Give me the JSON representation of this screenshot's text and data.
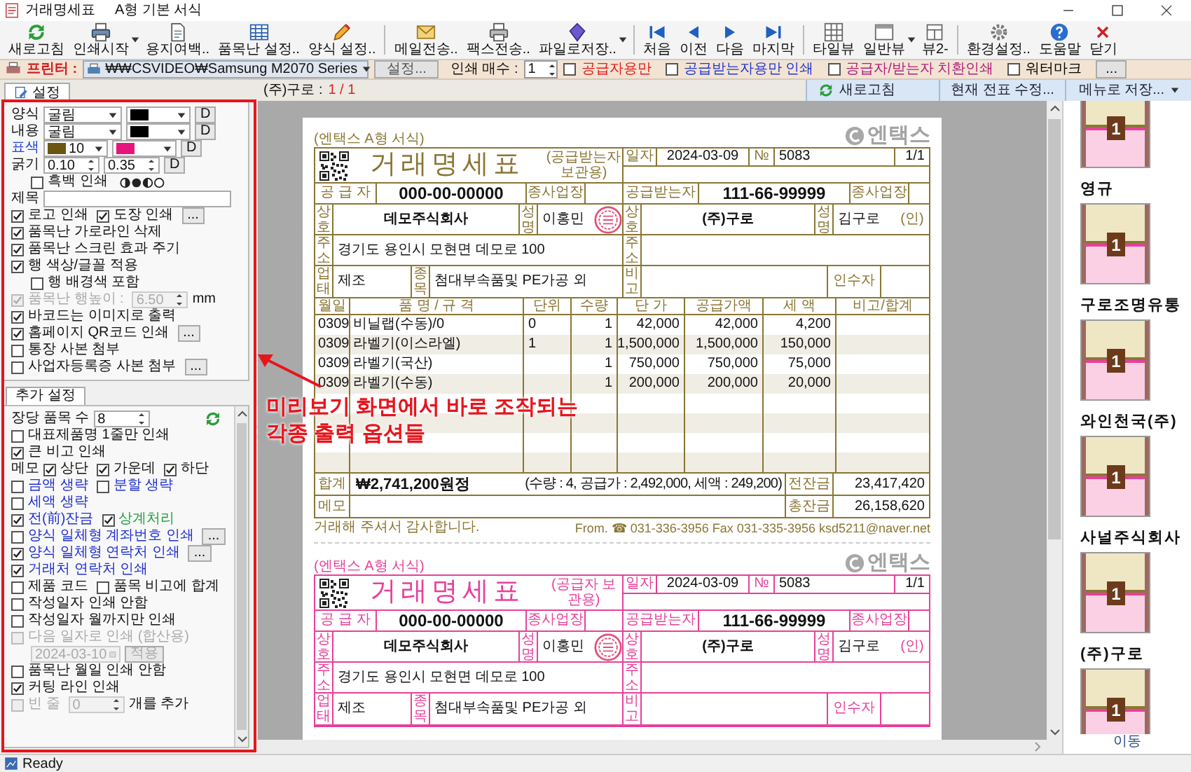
{
  "window": {
    "title": "거래명세표",
    "subtitle": "A형 기본 서식"
  },
  "toolbar": {
    "groups": [
      {
        "buttons": [
          {
            "label": "새로고침",
            "dropdown": false
          },
          {
            "label": "인쇄시작",
            "dropdown": true
          },
          {
            "label": "용지여백..",
            "dropdown": false
          },
          {
            "label": "품목난 설정..",
            "dropdown": false
          },
          {
            "label": "양식 설정..",
            "dropdown": false
          }
        ]
      },
      {
        "buttons": [
          {
            "label": "메일전송..",
            "dropdown": false
          },
          {
            "label": "팩스전송..",
            "dropdown": false
          },
          {
            "label": "파일로저장..",
            "dropdown": true
          }
        ]
      },
      {
        "buttons": [
          {
            "label": "처음",
            "dropdown": false
          },
          {
            "label": "이전",
            "dropdown": false
          },
          {
            "label": "다음",
            "dropdown": false
          },
          {
            "label": "마지막",
            "dropdown": false
          }
        ]
      },
      {
        "buttons": [
          {
            "label": "타일뷰",
            "dropdown": false
          },
          {
            "label": "일반뷰",
            "dropdown": true
          },
          {
            "label": "뷰2-",
            "dropdown": false
          }
        ]
      },
      {
        "buttons": [
          {
            "label": "환경설정..",
            "dropdown": false
          },
          {
            "label": "도움말",
            "dropdown": false
          },
          {
            "label": "닫기",
            "dropdown": false
          }
        ]
      }
    ]
  },
  "printer_bar": {
    "label": "프린터 :",
    "printer": "₩₩CSVIDEO₩Samsung M2070 Series",
    "setup_button": "설정...",
    "copies_label": "인쇄 매수 :",
    "copies": "1",
    "options": [
      {
        "label": "공급자용만",
        "checked": false,
        "color": "#e0201c"
      },
      {
        "label": "공급받는자용만 인쇄",
        "checked": false,
        "color": "#2038d0"
      },
      {
        "label": "공급자/받는자 치환인쇄",
        "checked": false,
        "color": "#b0207c"
      },
      {
        "label": "워터마크",
        "checked": false,
        "color": "#000000"
      }
    ],
    "more_button": "..."
  },
  "preview_header": {
    "customer": "(주)구로 :",
    "page": "1 / 1",
    "buttons": [
      {
        "label": "새로고침",
        "kind": "refresh"
      },
      {
        "label": "현재 전표 수정...",
        "kind": "plain"
      },
      {
        "label": "메뉴로 저장...",
        "kind": "dropdown"
      }
    ]
  },
  "settings_tab": {
    "label": "설정",
    "rows": [
      {
        "kind": "plain",
        "items": [
          {
            "kind": "text",
            "text": "양식"
          },
          {
            "kind": "combo",
            "value": "굴림"
          },
          {
            "kind": "swatch",
            "color": "#000000"
          },
          {
            "kind": "button",
            "label": "D"
          }
        ]
      },
      {
        "kind": "plain",
        "items": [
          {
            "kind": "text",
            "text": "내용"
          },
          {
            "kind": "combo",
            "value": "굴림"
          },
          {
            "kind": "swatch",
            "color": "#000000"
          },
          {
            "kind": "button",
            "label": "D"
          }
        ]
      },
      {
        "kind": "plain",
        "items": [
          {
            "kind": "text",
            "text": "표색",
            "color": "#2040e0"
          },
          {
            "kind": "swatch",
            "color": "#6b5514",
            "value": "10"
          },
          {
            "kind": "swatch",
            "color": "#e8147c"
          },
          {
            "kind": "button",
            "label": "D"
          }
        ]
      },
      {
        "kind": "plain",
        "items": [
          {
            "kind": "text",
            "text": "굵기"
          },
          {
            "kind": "spin",
            "value": "0.10"
          },
          {
            "kind": "spin",
            "value": "0.35"
          },
          {
            "kind": "button",
            "label": "D"
          }
        ]
      },
      {
        "kind": "indented",
        "items": [
          {
            "kind": "check",
            "label": "흑백 인쇄",
            "checked": false
          },
          {
            "kind": "icon"
          }
        ]
      },
      {
        "kind": "plain",
        "items": [
          {
            "kind": "text",
            "text": "제목"
          },
          {
            "kind": "field"
          }
        ]
      },
      {
        "kind": "plain",
        "items": [
          {
            "kind": "check",
            "label": "로고 인쇄",
            "checked": true
          },
          {
            "kind": "check",
            "label": "도장 인쇄",
            "checked": true
          },
          {
            "kind": "button",
            "label": "..."
          }
        ]
      },
      {
        "kind": "plain",
        "items": [
          {
            "kind": "check",
            "label": "품목난 가로라인 삭제",
            "checked": true
          }
        ]
      },
      {
        "kind": "plain",
        "items": [
          {
            "kind": "check",
            "label": "품목난 스크린 효과 주기",
            "checked": true
          }
        ]
      },
      {
        "kind": "plain",
        "items": [
          {
            "kind": "check",
            "label": "행 색상/글꼴 적용",
            "checked": true
          }
        ]
      },
      {
        "kind": "indented",
        "items": [
          {
            "kind": "check",
            "label": "행 배경색 포함",
            "checked": false
          }
        ]
      },
      {
        "kind": "plain",
        "items": [
          {
            "kind": "check",
            "label": "품목난 행높이 :",
            "checked": true,
            "disabled": true
          },
          {
            "kind": "spin",
            "value": "6.50",
            "disabled": true
          },
          {
            "kind": "text",
            "text": "mm"
          }
        ]
      },
      {
        "kind": "plain",
        "items": [
          {
            "kind": "check",
            "label": "바코드는 이미지로 출력",
            "checked": true
          }
        ]
      },
      {
        "kind": "plain",
        "items": [
          {
            "kind": "check",
            "label": "홈페이지 QR코드 인쇄",
            "checked": true
          },
          {
            "kind": "button",
            "label": "..."
          }
        ]
      },
      {
        "kind": "plain",
        "items": [
          {
            "kind": "check",
            "label": "통장 사본 첨부",
            "checked": false
          }
        ]
      },
      {
        "kind": "plain",
        "items": [
          {
            "kind": "check",
            "label": "사업자등록증 사본 첨부",
            "checked": false
          },
          {
            "kind": "button",
            "label": "..."
          }
        ]
      }
    ]
  },
  "extra_tab": {
    "label": "추가 설정",
    "rows": [
      {
        "kind": "plain",
        "items": [
          {
            "kind": "text",
            "text": "장당 품목 수"
          },
          {
            "kind": "spin",
            "value": "8"
          },
          {
            "kind": "refresh"
          }
        ]
      },
      {
        "kind": "plain",
        "items": [
          {
            "kind": "check",
            "label": "대표제품명 1줄만 인쇄",
            "checked": false
          }
        ]
      },
      {
        "kind": "plain",
        "items": [
          {
            "kind": "check",
            "label": "큰 비고 인쇄",
            "checked": true
          }
        ]
      },
      {
        "kind": "plain",
        "items": [
          {
            "kind": "text",
            "text": "메모"
          },
          {
            "kind": "check",
            "label": "상단",
            "checked": true
          },
          {
            "kind": "check",
            "label": "가운데",
            "checked": true
          },
          {
            "kind": "check",
            "label": "하단",
            "checked": true
          }
        ]
      },
      {
        "kind": "plain",
        "items": [
          {
            "kind": "check",
            "label": "금액 생략",
            "checked": false,
            "color": "#2030d0"
          },
          {
            "kind": "check",
            "label": "분할 생략",
            "checked": false,
            "color": "#2030d0"
          }
        ]
      },
      {
        "kind": "plain",
        "items": [
          {
            "kind": "check",
            "label": "세액 생략",
            "checked": false,
            "color": "#2030d0"
          }
        ]
      },
      {
        "kind": "plain",
        "items": [
          {
            "kind": "check",
            "label": "전(前)잔금",
            "checked": true,
            "color": "#2030d0"
          },
          {
            "kind": "check",
            "label": "상계처리",
            "checked": true,
            "color": "#20a040"
          }
        ]
      },
      {
        "kind": "plain",
        "items": [
          {
            "kind": "check",
            "label": "양식 일체형 계좌번호 인쇄",
            "checked": false,
            "color": "#2030d0"
          },
          {
            "kind": "button",
            "label": "..."
          }
        ]
      },
      {
        "kind": "plain",
        "items": [
          {
            "kind": "check",
            "label": "양식 일체형 연락처 인쇄",
            "checked": true,
            "color": "#2030d0"
          },
          {
            "kind": "button",
            "label": "..."
          }
        ]
      },
      {
        "kind": "plain",
        "items": [
          {
            "kind": "check",
            "label": "거래처 연락처 인쇄",
            "checked": true,
            "color": "#2030d0"
          }
        ]
      },
      {
        "kind": "plain",
        "items": [
          {
            "kind": "check",
            "label": "제품 코드",
            "checked": false
          },
          {
            "kind": "check",
            "label": "품목 비고에 합계",
            "checked": false
          }
        ]
      },
      {
        "kind": "plain",
        "items": [
          {
            "kind": "check",
            "label": "작성일자 인쇄 안함",
            "checked": false
          }
        ]
      },
      {
        "kind": "plain",
        "items": [
          {
            "kind": "check",
            "label": "작성일자 월까지만 인쇄",
            "checked": false
          }
        ]
      },
      {
        "kind": "plain",
        "items": [
          {
            "kind": "check",
            "label": "다음 일자로 인쇄 (합산용)",
            "checked": false,
            "disabled": true
          }
        ]
      },
      {
        "kind": "indented",
        "items": [
          {
            "kind": "date",
            "value": "2024-03-10",
            "disabled": true
          },
          {
            "kind": "button",
            "label": "적용",
            "disabled": true
          }
        ]
      },
      {
        "kind": "plain",
        "items": [
          {
            "kind": "check",
            "label": "품목난 월일 인쇄 안함",
            "checked": false
          }
        ]
      },
      {
        "kind": "plain",
        "items": [
          {
            "kind": "check",
            "label": "커팅 라인 인쇄",
            "checked": true
          }
        ]
      },
      {
        "kind": "plain",
        "items": [
          {
            "kind": "check",
            "label": "빈 줄",
            "checked": false,
            "disabled": true
          },
          {
            "kind": "spin",
            "value": "0",
            "disabled": true
          },
          {
            "kind": "text",
            "text": "개를 추가"
          }
        ]
      }
    ]
  },
  "preview": {
    "copies": [
      {
        "color": "#8a7634",
        "form_label": "(엔택스 A형 서식)",
        "logo": "엔택스",
        "title": "거래명세표",
        "copy_note": "(공급받는자 보관용)",
        "date_label": "일자",
        "date": "2024-03-09",
        "no_label": "№",
        "no": "5083",
        "page": "1/1",
        "supplier": {
          "label": "공 급 자",
          "reg_no": "000-00-00000",
          "branch_label": "종사업장",
          "name_label": "상호",
          "name": "데모주식회사",
          "ceo_label": "성명",
          "ceo": "이홍민",
          "address_label": "주소",
          "address": "경기도 용인시 모현면 데모로 100",
          "type_label": "업태",
          "type": "제조",
          "item_label": "종목",
          "item": "첨대부속품및 PE가공 외"
        },
        "buyer": {
          "label": "공급받는자",
          "reg_no": "111-66-99999",
          "branch_label": "종사업장",
          "name_label": "상호",
          "name": "(주)구로",
          "ceo_label": "성명",
          "ceo": "김구로",
          "seal": "(인)",
          "address_label": "주소",
          "note_label": "비고",
          "receiver_label": "인수자"
        },
        "columns": [
          "월일",
          "품 명 / 규 격",
          "단위",
          "수량",
          "단 가",
          "공급가액",
          "세 액",
          "비고/합계"
        ],
        "rows": [
          {
            "date": "0309",
            "item": "비닐랩(수동)/0",
            "unit": "0",
            "qty": "1",
            "price": "42,000",
            "supply": "42,000",
            "tax": "4,200"
          },
          {
            "date": "0309",
            "item": "라벨기(이스라엘)",
            "unit": "1",
            "qty": "1",
            "price": "1,500,000",
            "supply": "1,500,000",
            "tax": "150,000"
          },
          {
            "date": "0309",
            "item": "라벨기(국산)",
            "qty": "1",
            "price": "750,000",
            "supply": "750,000",
            "tax": "75,000"
          },
          {
            "date": "0309",
            "item": "라벨기(수동)",
            "qty": "1",
            "price": "200,000",
            "supply": "200,000",
            "tax": "20,000"
          }
        ],
        "total_label": "합계",
        "total": "₩2,741,200원정",
        "total_detail": "(수량 : 4, 공급가 : 2,492,000, 세액 : 249,200)",
        "prev_balance_label": "전잔금",
        "prev_balance": "23,417,420",
        "memo_label": "메모",
        "balance_label": "총잔금",
        "balance": "26,158,620",
        "footer_left": "거래해 주셔서 감사합니다.",
        "footer_right": "From. ☎ 031-336-3956 Fax 031-335-3956 ksd5211@naver.net"
      },
      {
        "color": "#e8409a",
        "form_label": "(엔택스 A형 서식)",
        "logo": "엔택스",
        "title": "거래명세표",
        "copy_note": "(공급자 보관용)",
        "date_label": "일자",
        "date": "2024-03-09",
        "no_label": "№",
        "no": "5083",
        "page": "1/1",
        "supplier": {
          "label": "공 급 자",
          "reg_no": "000-00-00000",
          "branch_label": "종사업장",
          "name_label": "상호",
          "name": "데모주식회사",
          "ceo_label": "성명",
          "ceo": "이홍민",
          "address_label": "주소",
          "address": "경기도 용인시 모현면 데모로 100",
          "type_label": "업태",
          "type": "제조",
          "item_label": "종목",
          "item": "첨대부속품및 PE가공 외"
        },
        "buyer": {
          "label": "공급받는자",
          "reg_no": "111-66-99999",
          "branch_label": "종사업장",
          "name_label": "상호",
          "name": "(주)구로",
          "ceo_label": "성명",
          "ceo": "김구로",
          "seal": "(인)",
          "address_label": "주소",
          "note_label": "비고",
          "receiver_label": "인수자"
        }
      }
    ]
  },
  "thumbnails": {
    "items": [
      {
        "badge": "1"
      },
      {
        "name": "영규",
        "badge": "1"
      },
      {
        "name": "구로조명유통",
        "badge": "1"
      },
      {
        "name": "와인천국(주)",
        "badge": "1"
      },
      {
        "name": "사널주식회사",
        "badge": "1"
      },
      {
        "name": "(주)구로",
        "badge": "1"
      }
    ],
    "move_link": "이동"
  },
  "annotation": {
    "lines": [
      "미리보기 화면에서 바로 조작되는",
      "각종 출력 옵션들"
    ]
  },
  "status_bar": {
    "text": "Ready"
  }
}
